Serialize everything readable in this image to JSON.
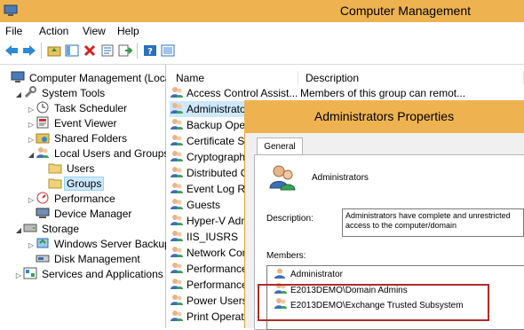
{
  "window": {
    "title": "Computer Management"
  },
  "menu": [
    "File",
    "Action",
    "View",
    "Help"
  ],
  "toolbar": {
    "icons": [
      "back-arrow-icon",
      "forward-arrow-icon",
      "up-folder-icon",
      "show-hide-tree-icon",
      "delete-icon",
      "properties-icon",
      "export-list-icon",
      "help-icon",
      "console-tree-icon"
    ]
  },
  "tree": [
    {
      "label": "Computer Management (Local",
      "indent": 0,
      "twisty": "",
      "icon": "computer-management-icon"
    },
    {
      "label": "System Tools",
      "indent": 1,
      "twisty": "◢",
      "icon": "tools-icon"
    },
    {
      "label": "Task Scheduler",
      "indent": 2,
      "twisty": "▷",
      "icon": "clock-icon"
    },
    {
      "label": "Event Viewer",
      "indent": 2,
      "twisty": "▷",
      "icon": "event-viewer-icon"
    },
    {
      "label": "Shared Folders",
      "indent": 2,
      "twisty": "▷",
      "icon": "shared-folder-icon"
    },
    {
      "label": "Local Users and Groups",
      "indent": 2,
      "twisty": "◢",
      "icon": "users-icon"
    },
    {
      "label": "Users",
      "indent": 3,
      "twisty": "",
      "icon": "folder-icon"
    },
    {
      "label": "Groups",
      "indent": 3,
      "twisty": "",
      "icon": "folder-icon",
      "selected": true
    },
    {
      "label": "Performance",
      "indent": 2,
      "twisty": "▷",
      "icon": "performance-icon"
    },
    {
      "label": "Device Manager",
      "indent": 2,
      "twisty": "",
      "icon": "device-manager-icon"
    },
    {
      "label": "Storage",
      "indent": 1,
      "twisty": "◢",
      "icon": "storage-icon"
    },
    {
      "label": "Windows Server Backup",
      "indent": 2,
      "twisty": "▷",
      "icon": "backup-icon"
    },
    {
      "label": "Disk Management",
      "indent": 2,
      "twisty": "",
      "icon": "disk-icon"
    },
    {
      "label": "Services and Applications",
      "indent": 1,
      "twisty": "▷",
      "icon": "services-icon"
    }
  ],
  "list": {
    "columns": [
      "Name",
      "Description"
    ],
    "rows": [
      {
        "name": "Access Control Assist...",
        "description": "Members of this group can remot..."
      },
      {
        "name": "Administrators",
        "description": "",
        "selected": true
      },
      {
        "name": "Backup Operators",
        "description": ""
      },
      {
        "name": "Certificate Service DCOM Access",
        "description": ""
      },
      {
        "name": "Cryptographic Operators",
        "description": ""
      },
      {
        "name": "Distributed COM Users",
        "description": ""
      },
      {
        "name": "Event Log Readers",
        "description": ""
      },
      {
        "name": "Guests",
        "description": ""
      },
      {
        "name": "Hyper-V Administrators",
        "description": ""
      },
      {
        "name": "IIS_IUSRS",
        "description": ""
      },
      {
        "name": "Network Configuration Operators",
        "description": ""
      },
      {
        "name": "Performance Log Users",
        "description": ""
      },
      {
        "name": "Performance Monitor Users",
        "description": ""
      },
      {
        "name": "Power Users",
        "description": ""
      },
      {
        "name": "Print Operators",
        "description": ""
      }
    ]
  },
  "dialog": {
    "title": "Administrators Properties",
    "tab": "General",
    "group_name": "Administrators",
    "description_label": "Description:",
    "description_value": "Administrators have complete and unrestricted access to the computer/domain",
    "members_label": "Members:",
    "members": [
      "Administrator",
      "E2013DEMO\\Domain Admins",
      "E2013DEMO\\Exchange Trusted Subsystem"
    ]
  },
  "colors": {
    "titlebar": "#eeb350",
    "selection": "#cde8ff",
    "highlight_border": "#b02a2a"
  }
}
